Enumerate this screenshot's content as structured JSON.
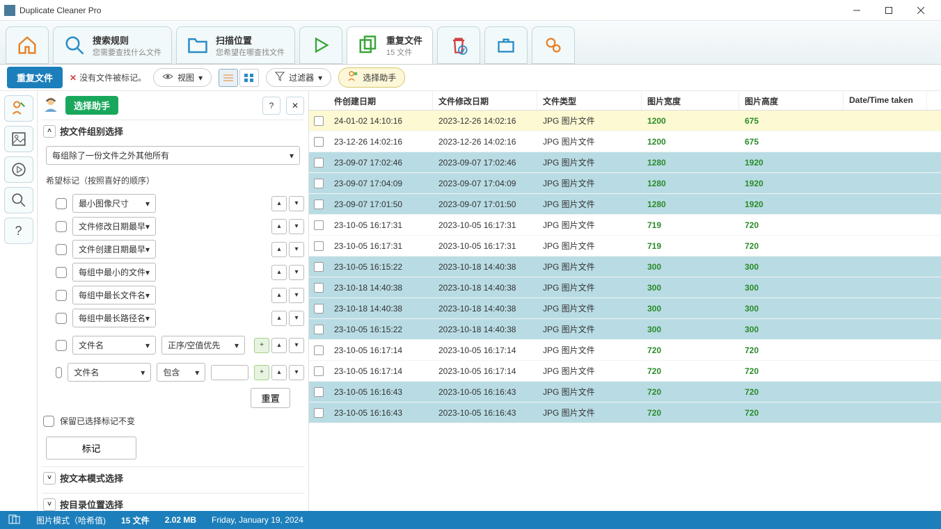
{
  "window": {
    "title": "Duplicate Cleaner Pro"
  },
  "tabs": {
    "home": {
      "label": "",
      "sub": ""
    },
    "rules": {
      "label": "搜索规则",
      "sub": "您需要查找什么文件"
    },
    "location": {
      "label": "扫描位置",
      "sub": "您希望在哪查找文件"
    },
    "duplicates": {
      "label": "重复文件",
      "sub": "15 文件"
    }
  },
  "subbar": {
    "btn_dup": "重复文件",
    "no_marked": "没有文件被标记。",
    "view": "视图",
    "filter": "过滤器",
    "assistant": "选择助手"
  },
  "sidebar": {
    "title": "选择助手",
    "section_group": "按文件组别选择",
    "group_mode": "每组除了一份文件之外其他所有",
    "pref_label": "希望标记（按照喜好的顺序）",
    "rules": [
      {
        "label": "最小图像尺寸"
      },
      {
        "label": "文件修改日期最早"
      },
      {
        "label": "文件创建日期最早"
      },
      {
        "label": "每组中最小的文件"
      },
      {
        "label": "每组中最长文件名"
      },
      {
        "label": "每组中最长路径名"
      }
    ],
    "filename_label": "文件名",
    "sort_label": "正序/空值优先",
    "contains_label": "包含",
    "reset": "重置",
    "keep_marked": "保留已选择标记不变",
    "mark_btn": "标记",
    "section_text": "按文本模式选择",
    "section_dir": "按目录位置选择"
  },
  "table": {
    "headers": {
      "created": "件创建日期",
      "modified": "文件修改日期",
      "type": "文件类型",
      "width": "图片宽度",
      "height": "图片高度",
      "datetime": "Date/Time taken"
    },
    "rows": [
      {
        "created": "24-01-02 14:10:16",
        "modified": "2023-12-26 14:02:16",
        "type": "JPG 图片文件",
        "width": "1200",
        "height": "675",
        "hl": "yellow"
      },
      {
        "created": "23-12-26 14:02:16",
        "modified": "2023-12-26 14:02:16",
        "type": "JPG 图片文件",
        "width": "1200",
        "height": "675",
        "hl": ""
      },
      {
        "created": "23-09-07 17:02:46",
        "modified": "2023-09-07 17:02:46",
        "type": "JPG 图片文件",
        "width": "1280",
        "height": "1920",
        "hl": "blue"
      },
      {
        "created": "23-09-07 17:04:09",
        "modified": "2023-09-07 17:04:09",
        "type": "JPG 图片文件",
        "width": "1280",
        "height": "1920",
        "hl": "blue"
      },
      {
        "created": "23-09-07 17:01:50",
        "modified": "2023-09-07 17:01:50",
        "type": "JPG 图片文件",
        "width": "1280",
        "height": "1920",
        "hl": "blue"
      },
      {
        "created": "23-10-05 16:17:31",
        "modified": "2023-10-05 16:17:31",
        "type": "JPG 图片文件",
        "width": "719",
        "height": "720",
        "hl": ""
      },
      {
        "created": "23-10-05 16:17:31",
        "modified": "2023-10-05 16:17:31",
        "type": "JPG 图片文件",
        "width": "719",
        "height": "720",
        "hl": ""
      },
      {
        "created": "23-10-05 16:15:22",
        "modified": "2023-10-18 14:40:38",
        "type": "JPG 图片文件",
        "width": "300",
        "height": "300",
        "hl": "blue"
      },
      {
        "created": "23-10-18 14:40:38",
        "modified": "2023-10-18 14:40:38",
        "type": "JPG 图片文件",
        "width": "300",
        "height": "300",
        "hl": "blue"
      },
      {
        "created": "23-10-18 14:40:38",
        "modified": "2023-10-18 14:40:38",
        "type": "JPG 图片文件",
        "width": "300",
        "height": "300",
        "hl": "blue"
      },
      {
        "created": "23-10-05 16:15:22",
        "modified": "2023-10-18 14:40:38",
        "type": "JPG 图片文件",
        "width": "300",
        "height": "300",
        "hl": "blue"
      },
      {
        "created": "23-10-05 16:17:14",
        "modified": "2023-10-05 16:17:14",
        "type": "JPG 图片文件",
        "width": "720",
        "height": "720",
        "hl": ""
      },
      {
        "created": "23-10-05 16:17:14",
        "modified": "2023-10-05 16:17:14",
        "type": "JPG 图片文件",
        "width": "720",
        "height": "720",
        "hl": ""
      },
      {
        "created": "23-10-05 16:16:43",
        "modified": "2023-10-05 16:16:43",
        "type": "JPG 图片文件",
        "width": "720",
        "height": "720",
        "hl": "blue"
      },
      {
        "created": "23-10-05 16:16:43",
        "modified": "2023-10-05 16:16:43",
        "type": "JPG 图片文件",
        "width": "720",
        "height": "720",
        "hl": "blue"
      }
    ]
  },
  "statusbar": {
    "mode": "图片模式（哈希值)",
    "count": "15 文件",
    "size": "2.02 MB",
    "date": "Friday, January 19, 2024"
  }
}
